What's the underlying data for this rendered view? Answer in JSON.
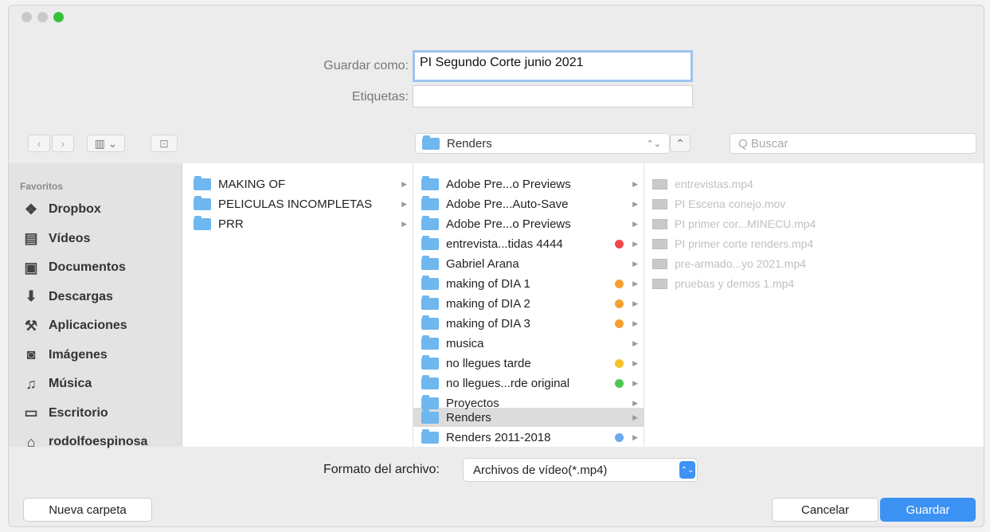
{
  "window": {
    "colors": {
      "close": "#c9c9c9",
      "minimize": "#c9c9c9",
      "zoom": "#36c13a"
    }
  },
  "save": {
    "name_label": "Guardar como:",
    "name_value": "PI Segundo Corte junio 2021",
    "tags_label": "Etiquetas:",
    "tags_value": ""
  },
  "toolbar": {
    "back_icon": "‹",
    "forward_icon": "›",
    "view_icon": "▥ ⌄",
    "new_folder_icon": "⊡",
    "path": "Renders",
    "path_stepper": "⌃⌄",
    "expand_icon": "⌃",
    "search_placeholder": "Q Buscar"
  },
  "sidebar": {
    "header": "Favoritos",
    "items": [
      {
        "label": "Dropbox",
        "icon": "dropbox-icon"
      },
      {
        "label": "Vídeos",
        "icon": "film-icon"
      },
      {
        "label": "Documentos",
        "icon": "documents-icon"
      },
      {
        "label": "Descargas",
        "icon": "download-icon"
      },
      {
        "label": "Aplicaciones",
        "icon": "applications-icon"
      },
      {
        "label": "Imágenes",
        "icon": "camera-icon"
      },
      {
        "label": "Música",
        "icon": "music-icon"
      },
      {
        "label": "Escritorio",
        "icon": "desktop-icon"
      },
      {
        "label": "rodolfoespinosa",
        "icon": "home-icon"
      }
    ]
  },
  "column1": {
    "items": [
      {
        "label": "MAKING OF"
      },
      {
        "label": "PELICULAS INCOMPLETAS",
        "selected": true
      },
      {
        "label": "PRR"
      }
    ]
  },
  "column2": {
    "items": [
      {
        "label": "Adobe Pre...o Previews",
        "tag": ""
      },
      {
        "label": "Adobe Pre...Auto-Save",
        "tag": ""
      },
      {
        "label": "Adobe Pre...o Previews",
        "tag": ""
      },
      {
        "label": "entrevista...tidas 4444",
        "tag": "#f04848"
      },
      {
        "label": "Gabriel Arana",
        "tag": ""
      },
      {
        "label": "making of DIA 1",
        "tag": "#f5a033"
      },
      {
        "label": "making of DIA 2",
        "tag": "#f5a033"
      },
      {
        "label": "making of DIA 3",
        "tag": "#f5a033"
      },
      {
        "label": "musica",
        "tag": ""
      },
      {
        "label": "no llegues tarde",
        "tag": "#f8c326"
      },
      {
        "label": "no llegues...rde original",
        "tag": "#4cc754"
      },
      {
        "label": "Proyectos",
        "tag": ""
      },
      {
        "label": "Renders",
        "tag": "",
        "selected": true
      },
      {
        "label": "Renders 2011-2018",
        "tag": "#6aa8f0"
      }
    ]
  },
  "column3": {
    "items": [
      {
        "label": "entrevistas.mp4"
      },
      {
        "label": "PI Escena conejo.mov"
      },
      {
        "label": "PI primer cor...MINECU.mp4"
      },
      {
        "label": "PI primer corte renders.mp4"
      },
      {
        "label": "pre-armado...yo 2021.mp4"
      },
      {
        "label": "pruebas y demos 1.mp4"
      }
    ]
  },
  "format": {
    "label": "Formato del archivo:",
    "value": "Archivos de vídeo(*.mp4)",
    "stepper": "⌃⌄"
  },
  "buttons": {
    "new_folder": "Nueva carpeta",
    "cancel": "Cancelar",
    "save": "Guardar"
  }
}
